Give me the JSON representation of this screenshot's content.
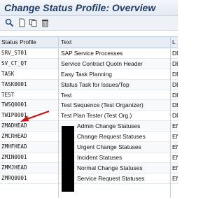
{
  "title": "Change Status Profile: Overview",
  "toolbar": {
    "icons": [
      "change-display-icon",
      "new-entries-icon",
      "copy-icon",
      "delete-icon"
    ]
  },
  "table": {
    "headers": [
      "Status Profile",
      "Text",
      "L"
    ],
    "rows": [
      {
        "profile": "SRV_ST01",
        "text": "SAP Service Processes",
        "lang": "DE"
      },
      {
        "profile": "SV_CT_QT",
        "text": "Service Contract Quotn Header",
        "lang": "DE"
      },
      {
        "profile": "TASK",
        "text": "Easy Task Planning",
        "lang": "DE"
      },
      {
        "profile": "TASK0001",
        "text": "Status Task for Issues/Top",
        "lang": "DE"
      },
      {
        "profile": "TEST",
        "text": "Test",
        "lang": "DE"
      },
      {
        "profile": "TWSQ0001",
        "text": "Test Sequence (Test Organizer)",
        "lang": "DE"
      },
      {
        "profile": "TWIP0001",
        "text": "Test Plan Tester (Test Org.)",
        "lang": "DE"
      },
      {
        "profile": "ZMADHEAD",
        "text": "Admin Change Statuses",
        "lang": "EN"
      },
      {
        "profile": "ZMCRHEAD",
        "text": "Change Request Statuses",
        "lang": "EN"
      },
      {
        "profile": "ZMHFHEAD",
        "text": "Urgent Change Statuses",
        "lang": "EN"
      },
      {
        "profile": "ZMIN0001",
        "text": "Incident Statuses",
        "lang": "EN"
      },
      {
        "profile": "ZMMJHEAD",
        "text": "Normal Change Statuses",
        "lang": "EN"
      },
      {
        "profile": "ZMRQ0001",
        "text": "Service Request Statuses",
        "lang": "EN"
      }
    ]
  },
  "colors": {
    "title": "#1f3c66",
    "header_bg": "#e7edf4",
    "arrow": "#d01010",
    "redaction": "#000000"
  }
}
